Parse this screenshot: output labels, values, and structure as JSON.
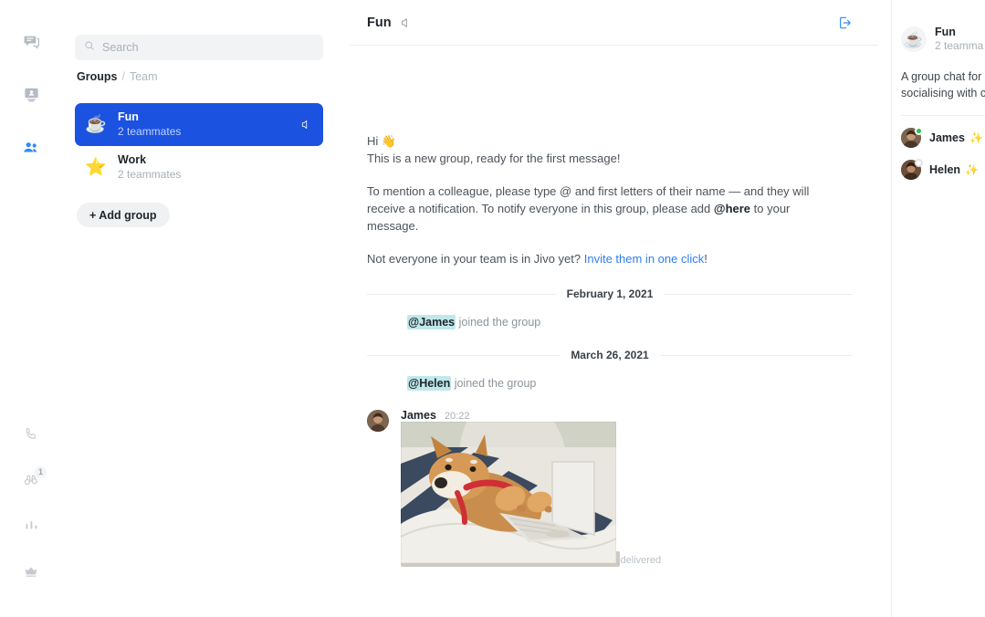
{
  "colors": {
    "accent_blue": "#1b52e0",
    "link_blue": "#2f7fe8",
    "icon_active_blue": "#2f8bf5",
    "icon_grey": "#b4bbc2",
    "mention_highlight": "#bfe8ea",
    "online_green": "#29c24a",
    "offline_grey": "#eceef0",
    "star_gold": "#f5a623",
    "sidebar_bg": "#ffffff",
    "search_bg": "#f1f3f5"
  },
  "rail": {
    "top_items": [
      {
        "name": "chats-icon",
        "label": "Chats",
        "active": false
      },
      {
        "name": "visitors-icon",
        "label": "Visitors",
        "active": false
      },
      {
        "name": "teamchat-icon",
        "label": "Team chat",
        "active": true
      }
    ],
    "bottom_items": [
      {
        "name": "phone-icon",
        "label": "Calls",
        "badge": ""
      },
      {
        "name": "binoculars-icon",
        "label": "Monitoring",
        "badge": "1"
      },
      {
        "name": "stats-icon",
        "label": "Statistics",
        "badge": ""
      },
      {
        "name": "crown-icon",
        "label": "Subscription",
        "badge": ""
      }
    ]
  },
  "sidebar": {
    "search": {
      "placeholder": "Search",
      "value": ""
    },
    "breadcrumb": {
      "current": "Groups",
      "separator": "/",
      "parent": "Team"
    },
    "groups": [
      {
        "avatar": "☕",
        "name": "Fun",
        "sub": "2 teammates",
        "selected": true,
        "muted": true
      },
      {
        "avatar": "⭐",
        "name": "Work",
        "sub": "2 teammates",
        "selected": false,
        "muted": false
      }
    ],
    "add_group_label": "+ Add group"
  },
  "chat": {
    "title": "Fun",
    "mute_icon": "speaker-muted-icon",
    "leave_icon": "leave-group-icon",
    "welcome": {
      "greeting": "Hi 👋",
      "line2": "This is a new group, ready for the first message!",
      "para_a": "To mention a colleague, please type @ and first letters of their name — and they will receive a notification. To notify everyone in this group, please add ",
      "para_a_bold": "@here",
      "para_a_tail": " to your message.",
      "para_b_pre": "Not everyone in your team is in Jivo yet? ",
      "para_b_link": "Invite them in one click",
      "para_b_tail": "!"
    },
    "timeline": [
      {
        "type": "date",
        "label": "February 1, 2021"
      },
      {
        "type": "system",
        "mention": "@James",
        "text": " joined the group"
      },
      {
        "type": "date",
        "label": "March 26, 2021"
      },
      {
        "type": "system",
        "mention": "@Helen",
        "text": " joined the group"
      }
    ],
    "message": {
      "author": "James",
      "time": "20:22",
      "attachment_alt": "Shiba Inu dog lying on a bed using a laptop",
      "status": "delivered"
    }
  },
  "info": {
    "avatar": "☕",
    "name": "Fun",
    "sub": "2 teamma",
    "description_line1": "A group chat for",
    "description_line2": "socialising with c",
    "members": [
      {
        "name": "James",
        "status": "online",
        "sparkle": "✨",
        "sparkle_active": true
      },
      {
        "name": "Helen",
        "status": "offline",
        "sparkle": "✨",
        "sparkle_active": false
      }
    ]
  }
}
